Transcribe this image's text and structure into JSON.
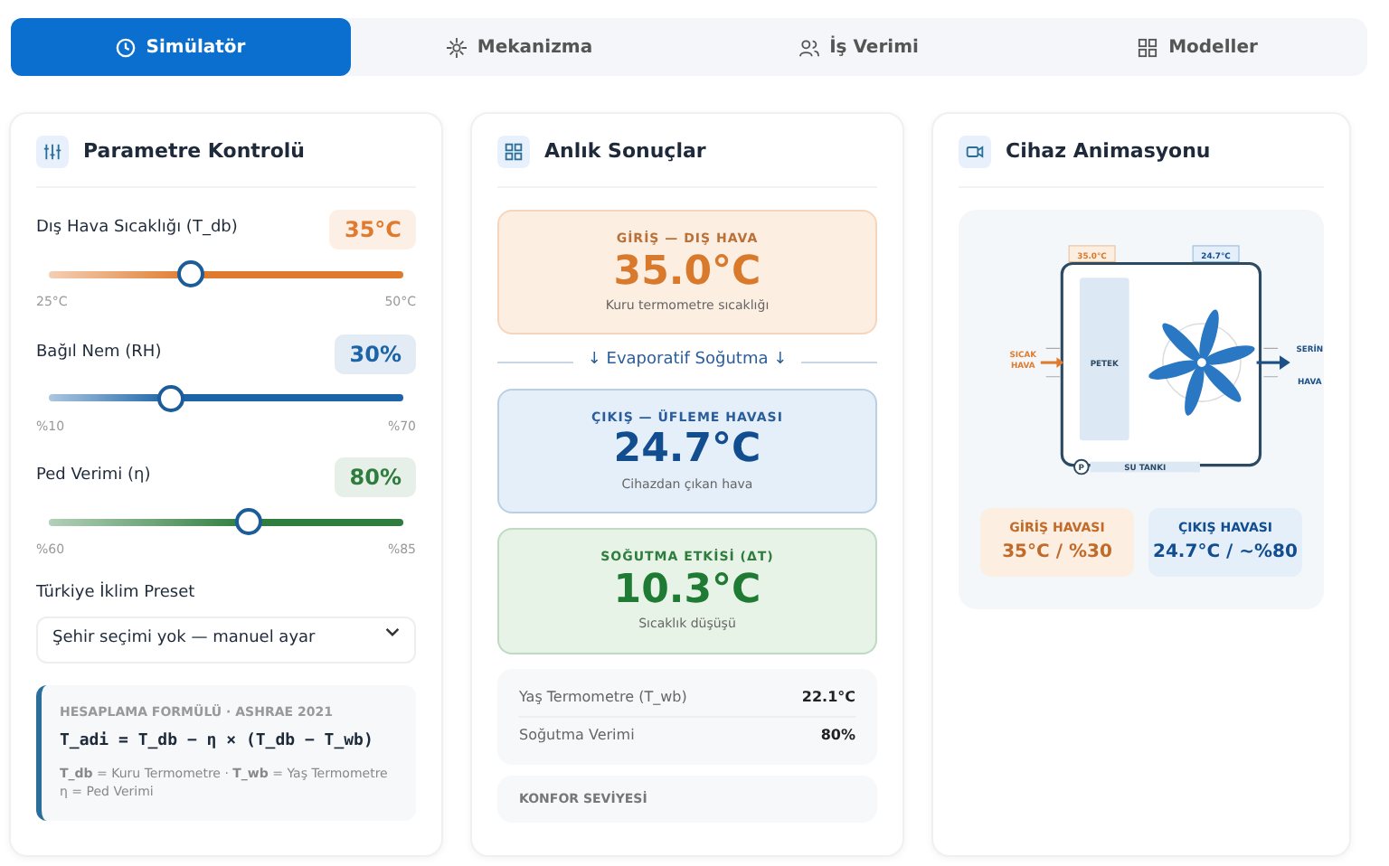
{
  "tabs": [
    {
      "label": "Simülatör",
      "selected": true
    },
    {
      "label": "Mekanizma",
      "selected": false
    },
    {
      "label": "İş Verimi",
      "selected": false
    },
    {
      "label": "Modeller",
      "selected": false
    }
  ],
  "parameters": {
    "title": "Parametre Kontrolü",
    "sliders": [
      {
        "label": "Dış Hava Sıcaklığı (T_db)",
        "value": "35°C",
        "min": "25°C",
        "max": "50°C",
        "level": 0.4
      },
      {
        "label": "Bağıl Nem (RH)",
        "value": "30%",
        "min": "%10",
        "max": "%70",
        "level": 0.34
      },
      {
        "label": "Ped Verimi (η)",
        "value": "80%",
        "min": "%60",
        "max": "%85",
        "level": 0.56
      }
    ],
    "preset": {
      "label": "Türkiye İklim Preset",
      "value": "Şehir seçimi yok — manuel ayar"
    },
    "formula": {
      "title": "HESAPLAMA FORMÜLÜ · ASHRAE 2021",
      "equation": "T_adi = T_db − η × (T_db − T_wb)",
      "legend": [
        "**T_db** = Kuru Termometre · **T_wb** = Yaş Termometre",
        "η = Ped Verimi"
      ]
    }
  },
  "results": {
    "title": "Anlık Sonuçlar",
    "cards": [
      {
        "kind": "inlet",
        "label": "GİRİŞ — DIŞ HAVA",
        "value": "35.0°C",
        "caption": "Kuru termometre sıcaklığı"
      },
      {
        "kind": "outlet",
        "label": "ÇIKIŞ — ÜFLEME HAVASI",
        "value": "24.7°C",
        "caption": "Cihazdan çıkan hava"
      },
      {
        "kind": "effect",
        "label": "SOĞUTMA ETKİSİ (ΔT)",
        "value": "10.3°C",
        "caption": "Sıcaklık düşüşü"
      }
    ],
    "divider": "↓ Evaporatif Soğutma ↓",
    "stats": [
      {
        "label": "Yaş Termometre (T_wb)",
        "value": "22.1°C"
      },
      {
        "label": "Soğutma Verimi",
        "value": "80%"
      }
    ],
    "comfort": {
      "title": "KONFOR SEVİYESİ"
    }
  },
  "animation": {
    "title": "Cihaz Animasyonu",
    "diagram": {
      "inlet_temp": "35.0°C",
      "outlet_temp": "24.7°C",
      "inlet_label": [
        "SICAK",
        "HAVA"
      ],
      "pad_label": "PETEK",
      "outlet_label": [
        "SERİN",
        "HAVA"
      ],
      "pump_label": "P",
      "tank_label": "SU TANKI"
    },
    "readouts": [
      {
        "kind": "inlet",
        "label": "GİRİŞ HAVASI",
        "value": "35°C / %30"
      },
      {
        "kind": "outlet",
        "label": "ÇIKIŞ HAVASI",
        "value": "24.7°C / ~%80"
      }
    ]
  }
}
